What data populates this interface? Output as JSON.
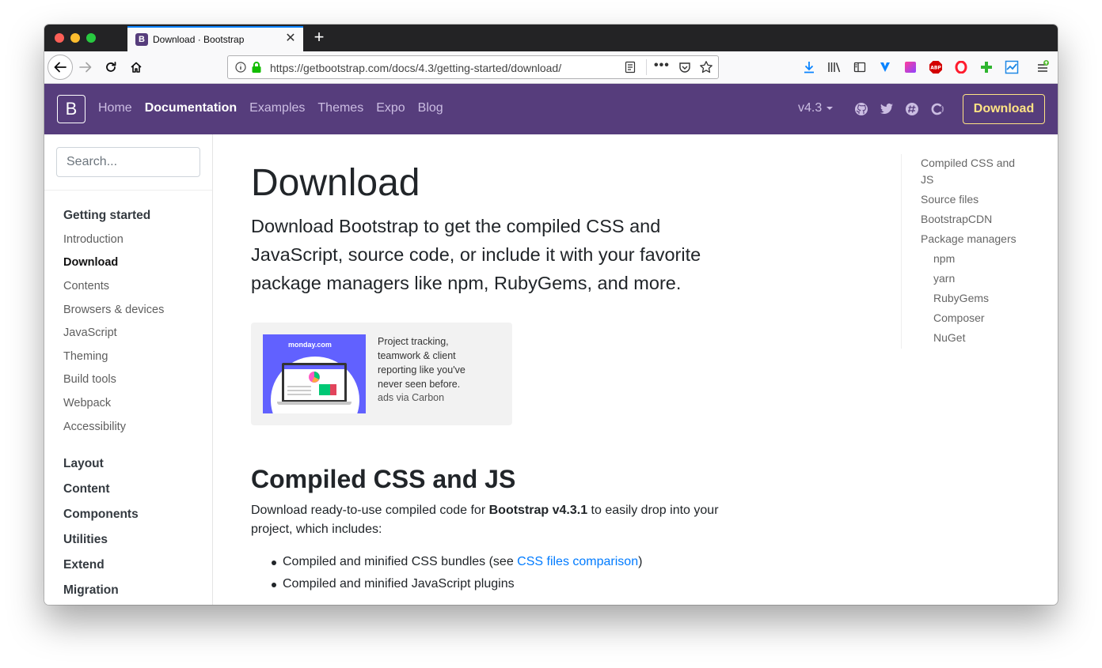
{
  "browser": {
    "tab_title": "Download · Bootstrap",
    "tab_favicon_letter": "B",
    "tab_close": "✕",
    "new_tab": "+",
    "url": "https://getbootstrap.com/docs/4.3/getting-started/download/",
    "url_more": "•••"
  },
  "navbar": {
    "brand": "B",
    "links": [
      "Home",
      "Documentation",
      "Examples",
      "Themes",
      "Expo",
      "Blog"
    ],
    "active_link": "Documentation",
    "version": "v4.3",
    "download_label": "Download",
    "colors": {
      "background": "#563d7c",
      "download_accent": "#ffe484"
    }
  },
  "sidebar": {
    "search_placeholder": "Search...",
    "getting_started_title": "Getting started",
    "getting_started_items": [
      "Introduction",
      "Download",
      "Contents",
      "Browsers & devices",
      "JavaScript",
      "Theming",
      "Build tools",
      "Webpack",
      "Accessibility"
    ],
    "active_item": "Download",
    "groups": [
      "Layout",
      "Content",
      "Components",
      "Utilities",
      "Extend",
      "Migration"
    ]
  },
  "main": {
    "title": "Download",
    "lead": "Download Bootstrap to get the compiled CSS and JavaScript, source code, or include it with your favorite package managers like npm, RubyGems, and more.",
    "ad": {
      "logo_text": "monday.com",
      "text": "Project tracking, teamwork & client reporting like you've never seen before.",
      "via": "ads via Carbon"
    },
    "section_title": "Compiled CSS and JS",
    "para_prefix": "Download ready-to-use compiled code for ",
    "para_bold": "Bootstrap v4.3.1",
    "para_suffix": " to easily drop into your project, which includes:",
    "bullet1_prefix": "Compiled and minified CSS bundles (see ",
    "bullet1_link": "CSS files comparison",
    "bullet1_suffix": ")",
    "bullet2": "Compiled and minified JavaScript plugins"
  },
  "toc": {
    "items": [
      "Compiled CSS and JS",
      "Source files",
      "BootstrapCDN",
      "Package managers"
    ],
    "subitems": [
      "npm",
      "yarn",
      "RubyGems",
      "Composer",
      "NuGet"
    ]
  }
}
